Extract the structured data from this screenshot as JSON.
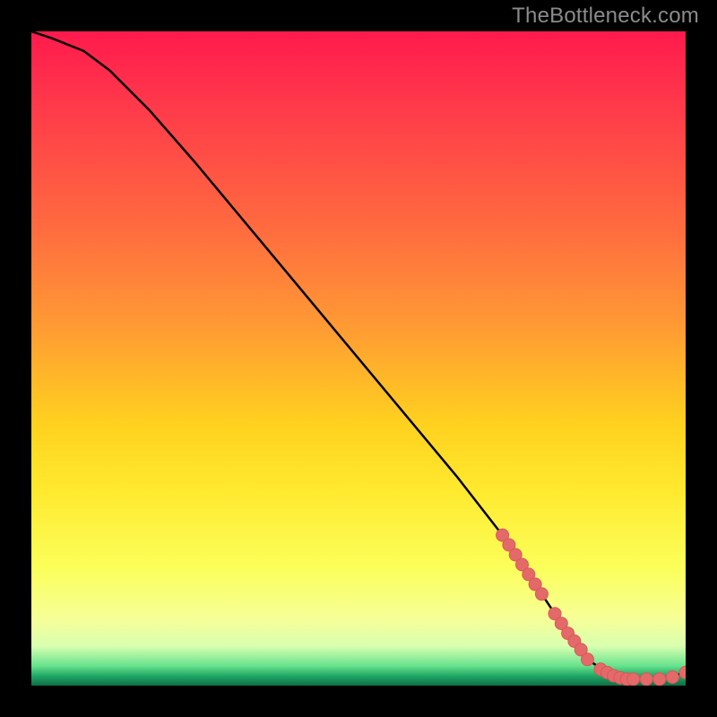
{
  "watermark": "TheBottleneck.com",
  "colors": {
    "background": "#000000",
    "curve": "#000000",
    "marker_fill": "#e46a6a",
    "marker_stroke": "#d95858",
    "gradient": [
      "#ff1a4d",
      "#ff6b3f",
      "#ffd11f",
      "#fbff5a",
      "#66e28c",
      "#0e6e45"
    ]
  },
  "chart_data": {
    "type": "line",
    "title": "",
    "xlabel": "",
    "ylabel": "",
    "xlim": [
      0,
      100
    ],
    "ylim": [
      0,
      100
    ],
    "series": [
      {
        "name": "curve",
        "x": [
          0,
          3,
          8,
          12,
          18,
          25,
          35,
          45,
          55,
          65,
          72,
          78,
          82,
          85,
          88,
          92,
          96,
          100
        ],
        "y": [
          100,
          99,
          97,
          94,
          88,
          80,
          68,
          56,
          44,
          32,
          23,
          14,
          8,
          4,
          2,
          1,
          1,
          2
        ]
      }
    ],
    "markers": [
      {
        "x": 72,
        "y": 23
      },
      {
        "x": 73,
        "y": 21.5
      },
      {
        "x": 74,
        "y": 20
      },
      {
        "x": 75,
        "y": 18.5
      },
      {
        "x": 76,
        "y": 17
      },
      {
        "x": 77,
        "y": 15.5
      },
      {
        "x": 78,
        "y": 14
      },
      {
        "x": 80,
        "y": 11
      },
      {
        "x": 81,
        "y": 9.5
      },
      {
        "x": 82,
        "y": 8
      },
      {
        "x": 83,
        "y": 6.8
      },
      {
        "x": 84,
        "y": 5.5
      },
      {
        "x": 85,
        "y": 4
      },
      {
        "x": 87,
        "y": 2.5
      },
      {
        "x": 88,
        "y": 2
      },
      {
        "x": 89,
        "y": 1.5
      },
      {
        "x": 90,
        "y": 1.2
      },
      {
        "x": 91,
        "y": 1
      },
      {
        "x": 92,
        "y": 1
      },
      {
        "x": 94,
        "y": 1
      },
      {
        "x": 96,
        "y": 1
      },
      {
        "x": 98,
        "y": 1.3
      },
      {
        "x": 100,
        "y": 2
      }
    ]
  }
}
